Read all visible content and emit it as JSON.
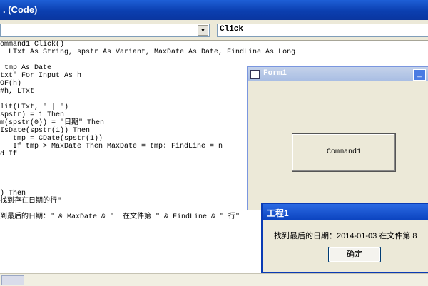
{
  "window": {
    "title": ". (Code)"
  },
  "toolbar": {
    "object_combo": "",
    "proc_combo": "Click"
  },
  "code_lines": [
    "ommand1_Click()",
    "  LTxt As String, spstr As Variant, MaxDate As Date, FindLine As Long",
    "",
    " tmp As Date",
    "txt\" For Input As h",
    "OF(h)",
    "#h, LTxt",
    "",
    "lit(LTxt, \" | \")",
    "spstr) = 1 Then",
    "m(spstr(0)) = \"日期\" Then",
    "IsDate(spstr(1)) Then",
    "   tmp = CDate(spstr(1))",
    "   If tmp > MaxDate Then MaxDate = tmp: FindLine = n",
    "d If",
    "",
    "",
    "",
    "",
    ") Then",
    "找到存在日期的行\"",
    "",
    "到最后的日期：\" & MaxDate & \"  在文件第 \" & FindLine & \" 行\""
  ],
  "form1": {
    "title": "Form1",
    "button_label": "Command1",
    "minimize_glyph": "_"
  },
  "msgbox": {
    "title": "工程1",
    "text": "找到最后的日期：2014-01-03   在文件第 8",
    "ok_label": "确定"
  }
}
